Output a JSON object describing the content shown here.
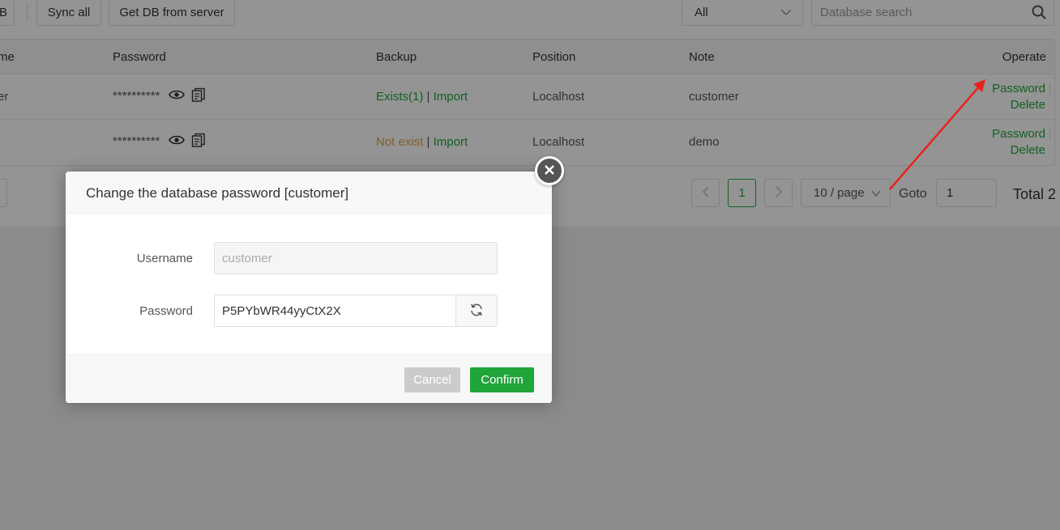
{
  "toolbar": {
    "partial_button_label": "B",
    "sync_all_label": "Sync all",
    "get_db_label": "Get DB from server",
    "filter_value": "All",
    "search_placeholder": "Database search"
  },
  "table": {
    "columns": {
      "name_partial": "me",
      "password": "Password",
      "backup": "Backup",
      "position": "Position",
      "note": "Note",
      "operate": "Operate"
    },
    "rows": [
      {
        "name_partial": "er",
        "password_mask": "**********",
        "backup_status": "Exists(1)",
        "backup_sep": "|",
        "backup_import": "Import",
        "position": "Localhost",
        "note": "customer",
        "op_password": "Password",
        "op_delete": "Delete"
      },
      {
        "name_partial": "",
        "password_mask": "**********",
        "backup_status": "Not exist",
        "backup_sep": "|",
        "backup_import": "Import",
        "position": "Localhost",
        "note": "demo",
        "op_password": "Password",
        "op_delete": "Delete"
      }
    ]
  },
  "pagination": {
    "current_page": "1",
    "page_size": "10 / page",
    "goto_label": "Goto",
    "goto_value": "1",
    "total": "Total 2"
  },
  "dialog": {
    "title": "Change the database password [customer]",
    "username_label": "Username",
    "username_value": "customer",
    "password_label": "Password",
    "password_value": "P5PYbWR44yyCtX2X",
    "cancel_label": "Cancel",
    "confirm_label": "Confirm"
  },
  "colors": {
    "accent_green": "#20a53a",
    "warning_orange": "#e0a050",
    "annotation_red": "#e8231e"
  }
}
